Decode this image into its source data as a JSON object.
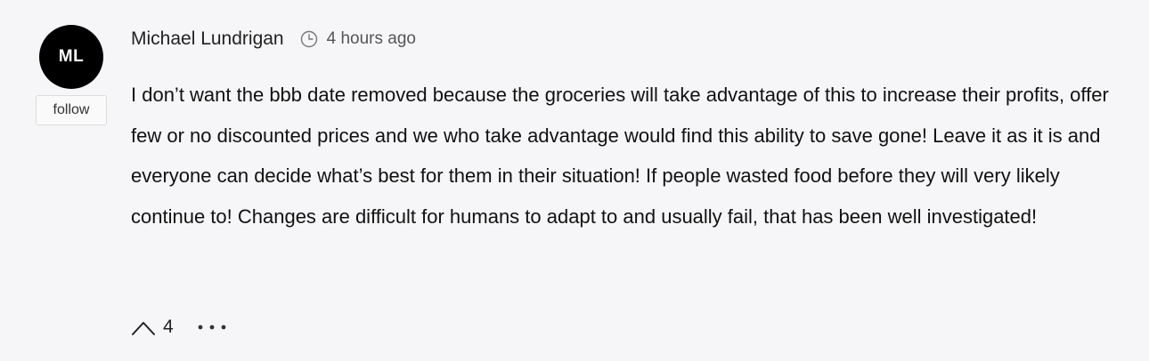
{
  "comment": {
    "avatar_initials": "ML",
    "follow_label": "follow",
    "author": "Michael Lundrigan",
    "time_icon": "clock-icon",
    "time": "4 hours ago",
    "text": "I don’t want the bbb date removed because the groceries will take advantage of this to increase their profits, offer few or no discounted prices and we who take advantage would find this ability to save gone! Leave it as it is and everyone can decide what’s best for them in their situation! If people wasted food before they will very likely continue to! Changes are difficult for humans to adapt to and usually fail, that has been well investigated!",
    "upvote_icon": "chevron-up-icon",
    "upvote_count": "4",
    "more_icon": "more-options-icon"
  },
  "colors": {
    "background": "#f6f6f8",
    "avatar_bg": "#000000",
    "text": "#111111"
  }
}
